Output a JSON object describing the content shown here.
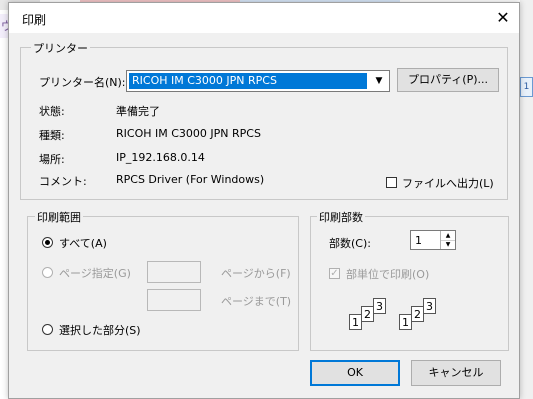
{
  "background": {
    "side_char": "ヴ",
    "right_button_label": "1"
  },
  "dialog": {
    "title": "印刷",
    "close_icon": "close-icon"
  },
  "printer_group": {
    "title": "プリンター",
    "name_label": "プリンター名(N):",
    "selected_printer": "RICOH IM C3000 JPN RPCS",
    "properties_button": "プロパティ(P)...",
    "status_label": "状態:",
    "status_value": "準備完了",
    "type_label": "種類:",
    "type_value": "RICOH IM C3000 JPN RPCS",
    "location_label": "場所:",
    "location_value": "IP_192.168.0.14",
    "comment_label": "コメント:",
    "comment_value": "RPCS Driver (For Windows)",
    "print_to_file_label": "ファイルへ出力(L)",
    "print_to_file_checked": false
  },
  "range_group": {
    "title": "印刷範囲",
    "all_label": "すべて(A)",
    "all_selected": true,
    "pages_label": "ページ指定(G)",
    "from_label": "ページから(F)",
    "to_label": "ページまで(T)",
    "from_value": "",
    "to_value": "",
    "selection_label": "選択した部分(S)"
  },
  "copies_group": {
    "title": "印刷部数",
    "copies_label": "部数(C):",
    "copies_value": "1",
    "collate_label": "部単位で印刷(O)",
    "collate_checked": true,
    "collate_icon_sets": [
      [
        "1",
        "2",
        "3"
      ],
      [
        "1",
        "2",
        "3"
      ]
    ]
  },
  "buttons": {
    "ok": "OK",
    "cancel": "キャンセル"
  }
}
